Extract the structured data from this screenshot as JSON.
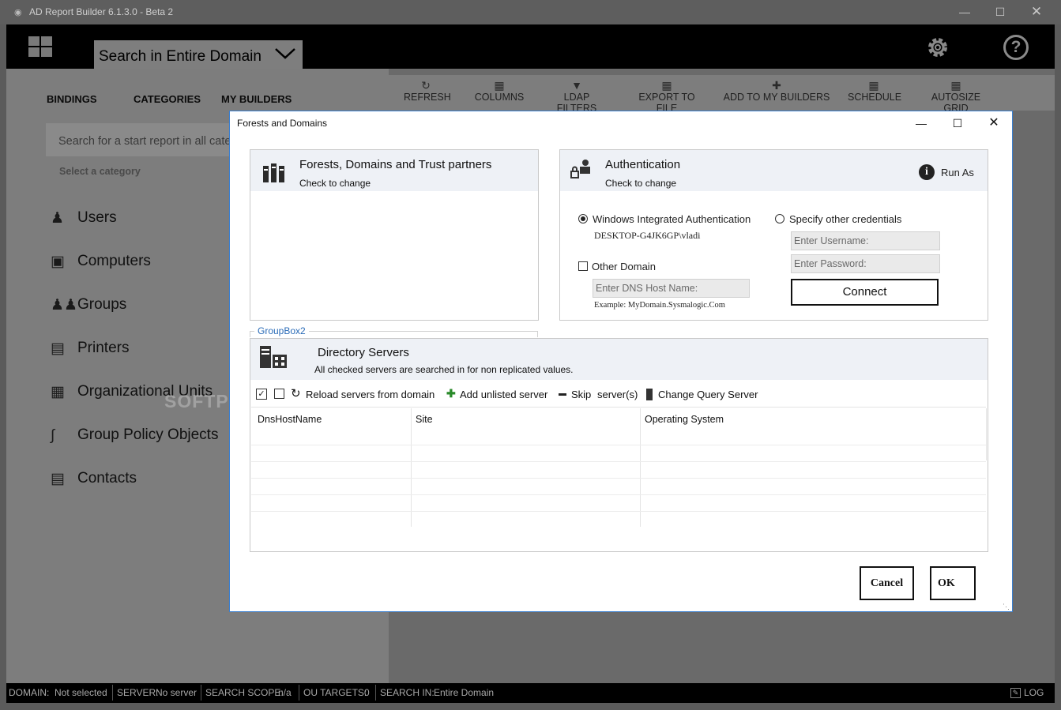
{
  "window": {
    "title": "AD Report Builder 6.1.3.0 - Beta 2"
  },
  "header": {
    "scope_label": "Search in Entire Domain"
  },
  "toolbar": {
    "refresh": "REFRESH",
    "columns": "COLUMNS",
    "ldap_filters": "LDAP FILTERS",
    "export": "EXPORT TO FILE",
    "add_builders": "ADD TO MY BUILDERS",
    "schedule": "SCHEDULE",
    "autosize": "AUTOSIZE GRID"
  },
  "nav": {
    "bindings": "BINDINGS",
    "categories": "CATEGORIES",
    "my_builders": "MY BUILDERS"
  },
  "search": {
    "placeholder": "Search for a start report in all categories"
  },
  "select_category": "Select a category",
  "categories": [
    "Users",
    "Computers",
    "Groups",
    "Printers",
    "Organizational Units",
    "Group Policy Objects",
    "Contacts"
  ],
  "watermark": "SOFTPEDIA",
  "status": {
    "domain_label": "DOMAIN:",
    "domain_value": "Not selected",
    "server_label": "SERVER:",
    "server_value": "No server",
    "scope_label": "SEARCH SCOPE:",
    "scope_value": "n/a",
    "ou_label": "OU TARGETS:",
    "ou_value": "0",
    "searchin_label": "SEARCH IN:",
    "searchin_value": "Entire Domain",
    "log": "LOG"
  },
  "dialog": {
    "title": "Forests and Domains",
    "forests": {
      "title": "Forests, Domains and Trust partners",
      "subtitle": "Check to change"
    },
    "auth": {
      "title": "Authentication",
      "subtitle": "Check to change",
      "run_as": "Run As",
      "windows_auth": "Windows Integrated Authentication",
      "current_user": "DESKTOP-G4JK6GP\\vladi",
      "other_creds": "Specify other credentials",
      "username_placeholder": "Enter Username:",
      "password_placeholder": "Enter Password:",
      "other_domain": "Other Domain",
      "dns_placeholder": "Enter DNS Host Name:",
      "example": "Example: MyDomain.Sysmalogic.Com",
      "connect": "Connect"
    },
    "groupbox": "GroupBox2",
    "servers": {
      "title": "Directory Servers",
      "subtitle": "All checked servers are searched in for non replicated values.",
      "reload": "Reload servers from domain",
      "add": "Add unlisted server",
      "skip": "Skip",
      "skip_suffix": "server(s)",
      "change": "Change Query Server",
      "columns": [
        "DnsHostName",
        "Site",
        "Operating System"
      ]
    },
    "cancel": "Cancel",
    "ok": "OK"
  }
}
